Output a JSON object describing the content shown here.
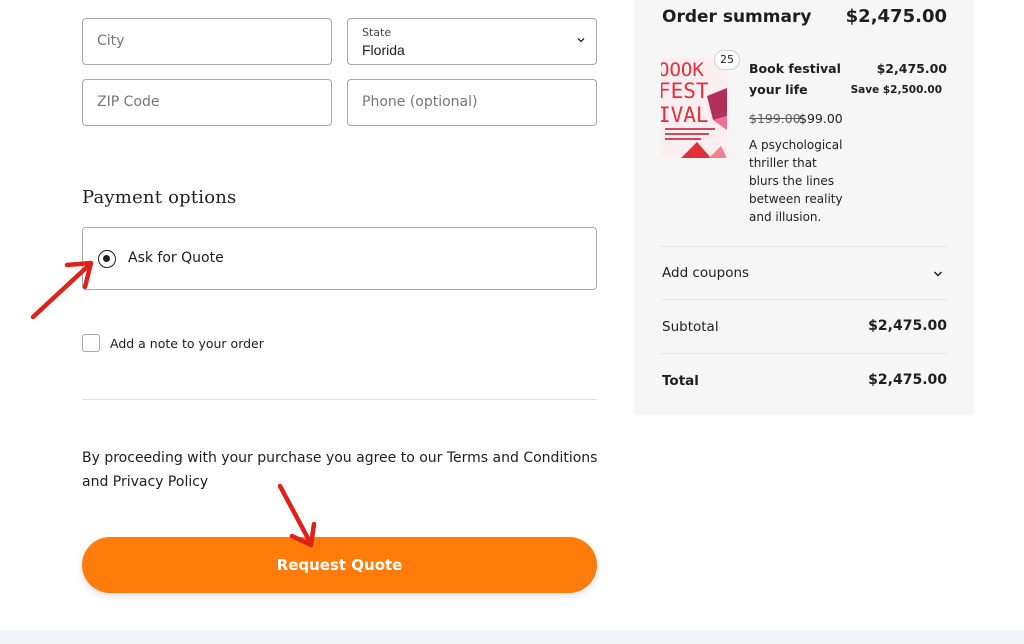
{
  "address": {
    "city_placeholder": "City",
    "state_label": "State",
    "state_value": "Florida",
    "zip_placeholder": "ZIP Code",
    "phone_placeholder": "Phone (optional)"
  },
  "payment": {
    "heading": "Payment options",
    "option_label": "Ask for Quote",
    "selected": true
  },
  "note": {
    "label": "Add a note to your order",
    "checked": false
  },
  "terms": {
    "text_before": "By proceeding with your purchase you agree to our ",
    "terms_link": "Terms and Conditions",
    "and": " and ",
    "privacy_link": "Privacy Policy"
  },
  "submit": {
    "label": "Request Quote"
  },
  "summary": {
    "title": "Order summary",
    "total_head": "$2,475.00",
    "item": {
      "quantity": "25",
      "name": "Book festival your life",
      "line_total": "$2,475.00",
      "save": "Save $2,500.00",
      "old_price": "$199.00",
      "new_price": "$99.00",
      "description": "A psychological thriller that blurs the lines between reality and illusion.",
      "cover_text": [
        "OOOK",
        "FEST",
        "IVAL"
      ]
    },
    "coupons_label": "Add coupons",
    "subtotal_label": "Subtotal",
    "subtotal_value": "$2,475.00",
    "total_label": "Total",
    "total_value": "$2,475.00"
  },
  "colors": {
    "accent": "#ff7b0a",
    "annotation_arrow": "#e0201b",
    "summary_bg": "#f6f6f6"
  },
  "icons": {
    "state_dropdown": "chevron-down-icon",
    "coupons_toggle": "chevron-down-icon",
    "annotation": "arrow-icon"
  }
}
